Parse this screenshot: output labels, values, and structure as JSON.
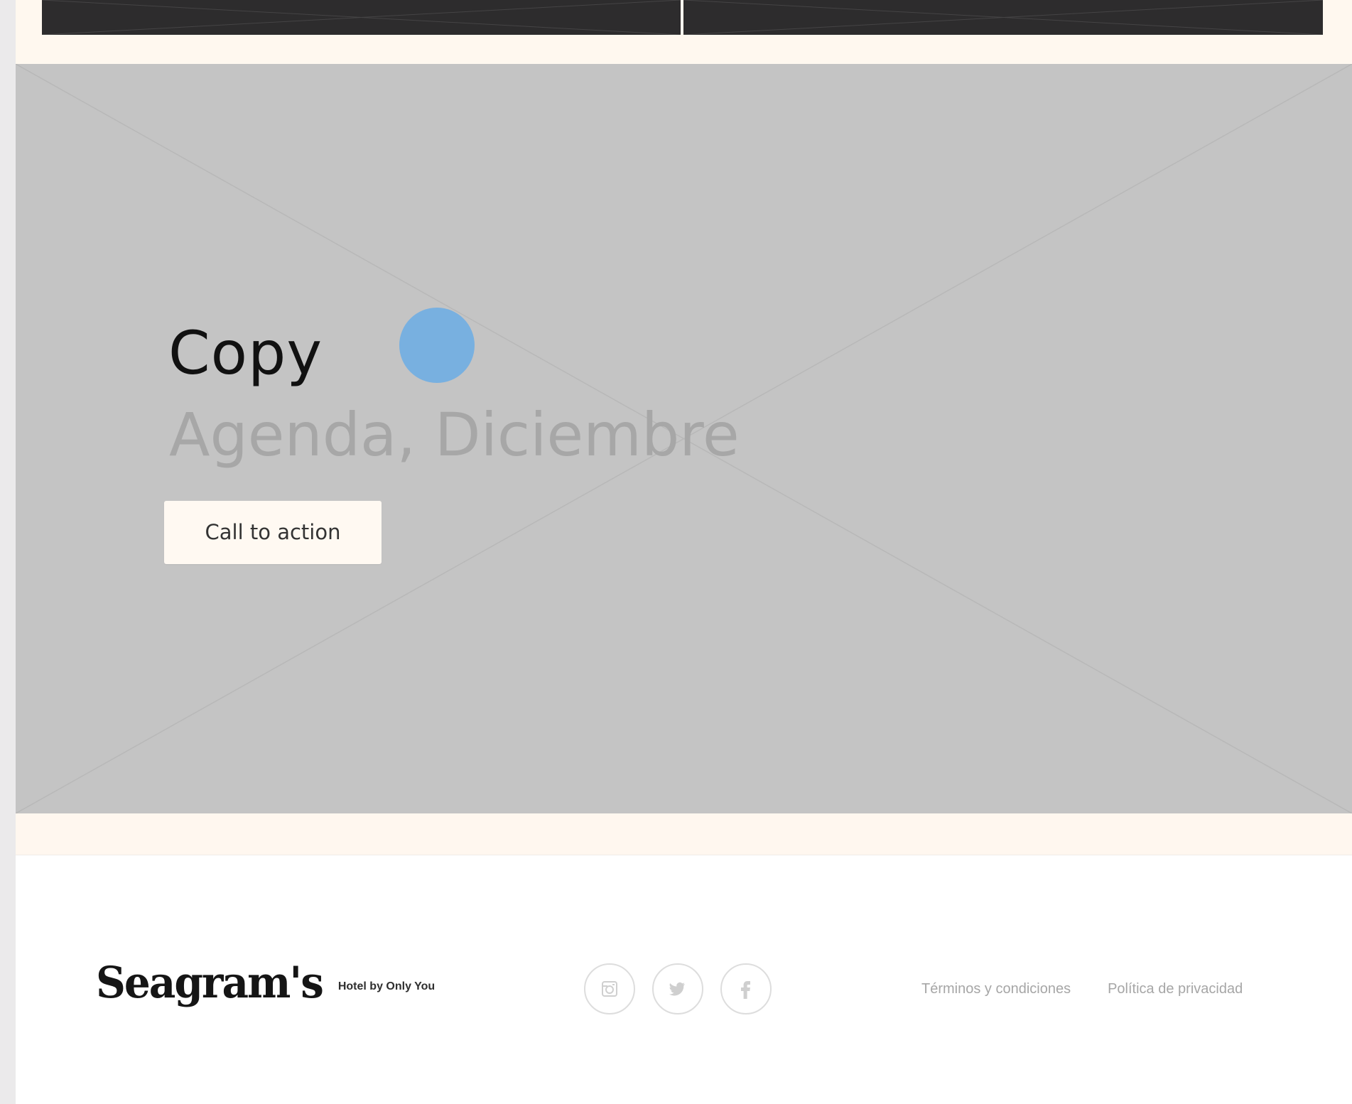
{
  "hero": {
    "title": "Copy",
    "subtitle": "Agenda, Diciembre",
    "cta_label": "Call to action"
  },
  "footer": {
    "brand_name": "Seagram's",
    "brand_tagline": "Hotel by Only You",
    "social_icons": [
      "instagram-icon",
      "twitter-icon",
      "facebook-icon"
    ],
    "links": {
      "terms": "Términos y condiciones",
      "privacy": "Política de privacidad"
    }
  },
  "colors": {
    "page_bg": "#fffaf4",
    "hero_placeholder": "#c4c4c4",
    "top_card": "#2d2c2d",
    "cursor_dot": "#78b0e0",
    "footer_bg": "#ffffff"
  }
}
